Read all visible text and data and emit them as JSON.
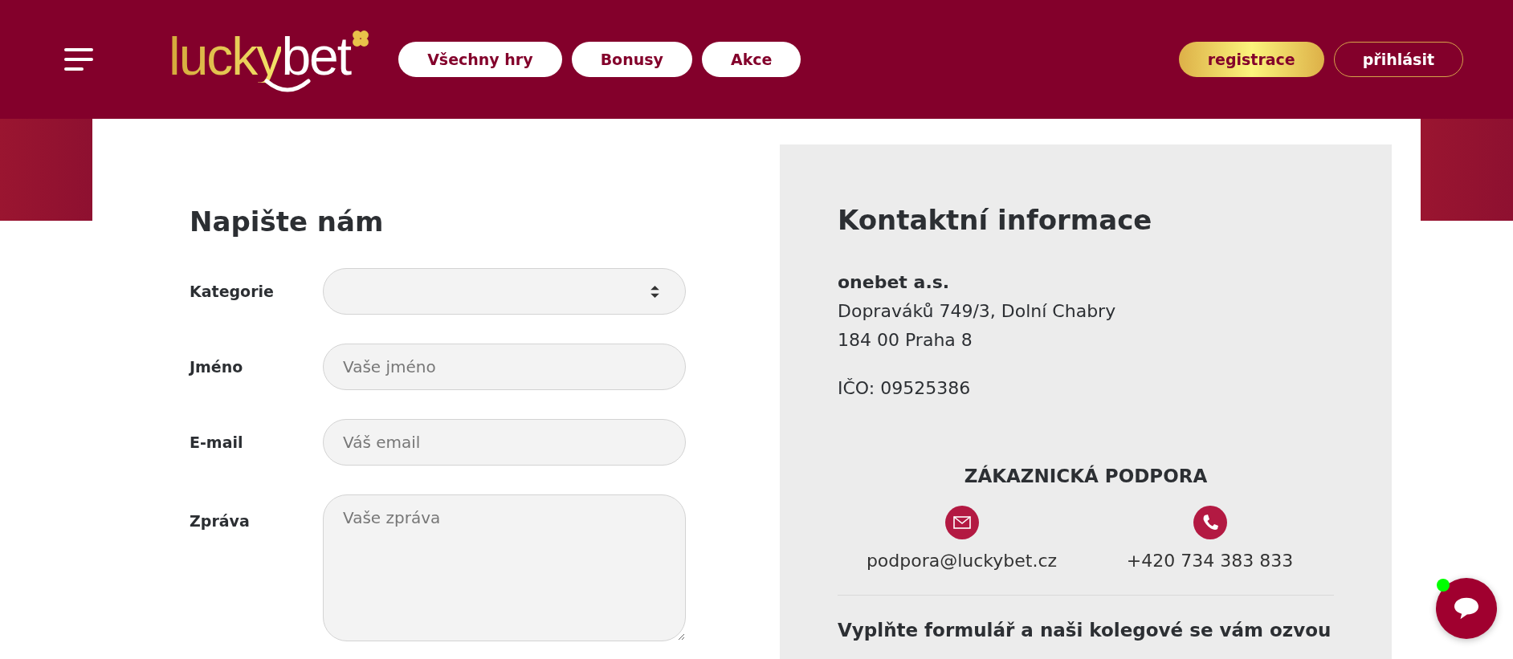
{
  "header": {
    "logo": {
      "part_1": "lucky",
      "part_2": "bet"
    },
    "nav": [
      {
        "label": "Všechny hry"
      },
      {
        "label": "Bonusy"
      },
      {
        "label": "Akce"
      }
    ],
    "register": "registrace",
    "login": "přihlásit"
  },
  "form": {
    "title": "Napište nám",
    "fields": [
      {
        "kind": "select",
        "label": "Kategorie"
      },
      {
        "kind": "input",
        "label": "Jméno",
        "placeholder": "Vaše jméno"
      },
      {
        "kind": "input",
        "label": "E-mail",
        "placeholder": "Váš email"
      },
      {
        "kind": "textarea",
        "label": "Zpráva",
        "placeholder": "Vaše zpráva"
      }
    ]
  },
  "contact": {
    "title": "Kontaktní informace",
    "company": "onebet a.s.",
    "address": [
      "Dopraváků 749/3, Dolní Chabry",
      "184 00 Praha 8"
    ],
    "ico": "IČO: 09525386",
    "support_title": "ZÁKAZNICKÁ PODPORA",
    "channels": [
      {
        "kind": "email",
        "value": "podpora@luckybet.cz"
      },
      {
        "kind": "phone",
        "value": "+420 734 383 833"
      }
    ],
    "note": "Vyplňte formulář a naši kolegové se vám ozvou"
  },
  "chat": {
    "online": true
  }
}
